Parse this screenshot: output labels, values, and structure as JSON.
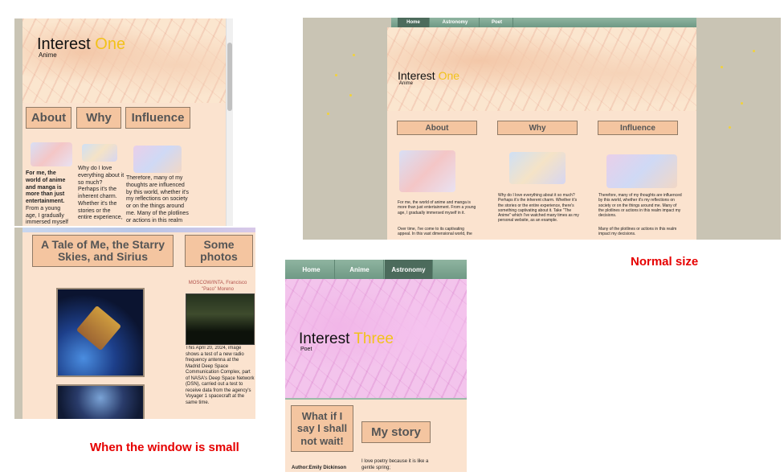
{
  "colors": {
    "accent": "#f2c21a",
    "label": "#e60000",
    "tab_fill": "#f4c5a0",
    "content_bg": "#fbe3cf"
  },
  "small_one": {
    "title_main": "Interest ",
    "title_accent": "One",
    "subtitle": "Anime",
    "tabs": [
      "About",
      "Why",
      "Influence"
    ],
    "col1_bold": "For me, the world of anime and manga is more than just entertainment.",
    "col1_text": "From a young age, I gradually immersed myself in",
    "col2_text": "Why do I love everything about it so much? Perhaps it's the inherent charm. Whether it's the stories or the entire experience, there's something",
    "col3_text": "Therefore, many of my thoughts are influenced by this world, whether it's my reflections on society or on the things around me. Many of the plotlines or actions in this realm impact"
  },
  "small_two": {
    "heading_left": "A Tale of Me, the Starry Skies, and Sirius",
    "heading_right": "Some photos",
    "caption_source": "MOSCOW/INTA, Francisco \"Paco\" Moreno",
    "caption_body": "This April 20, 2024, image shows a test of a new radio frequency antenna at the Madrid Deep Space Communication Complex, part of NASA's Deep Space Network (DSN), carried out a test to receive data from the agency's Voyager 1 spacecraft at the same time."
  },
  "normal": {
    "nav": [
      "Home",
      "Astronomy",
      "Poet"
    ],
    "title_main": "Interest ",
    "title_accent": "One",
    "subtitle": "Anime",
    "tabs": [
      "About",
      "Why",
      "Influence"
    ],
    "col1_text": "For me, the world of anime and manga is more than just entertainment. From a young age, I gradually immersed myself in it.",
    "col1_extra": "Over time, I've come to its captivating appeal. In this vast dimensional world, the",
    "col2_text": "Why do I love everything about it so much? Perhaps it's the inherent charm. Whether it's the stories or the entire experience, there's something captivating about it. Take \"The Anime\" which I've watched many times as my personal website, as an example.",
    "col3_text": "Therefore, many of my thoughts are influenced by this world, whether it's my reflections on society or on the things around me. Many of the plotlines or actions in this realm impact my decisions.",
    "col3_extra": "Many of the plotlines or actions in this realm impact my decisions."
  },
  "small_three": {
    "nav": [
      "Home",
      "Anime",
      "Astronomy"
    ],
    "title_main": "Interest ",
    "title_accent": "Three",
    "subtitle": "Poet",
    "tab_left": "What if I say I shall not wait!",
    "tab_right": "My story",
    "author": "Author:Emily Dickinson",
    "story_text": "I love poetry because it is like a gentle spring;"
  },
  "labels": {
    "normal": "Normal size",
    "small": "When the window is small"
  }
}
